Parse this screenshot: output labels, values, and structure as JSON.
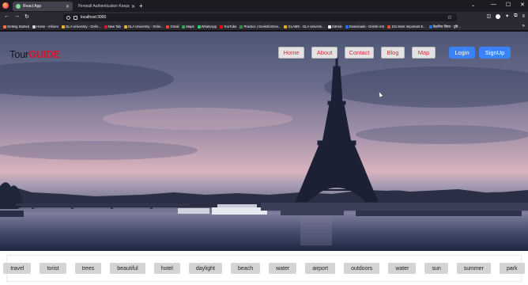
{
  "browser": {
    "tabs": [
      {
        "title": "React App",
        "active": true,
        "icon_color": "#7cd79a"
      },
      {
        "title": "Firewall Authentication Keepalive ...",
        "active": false,
        "icon_color": "#42414d"
      }
    ],
    "new_tab_label": "+",
    "url": "localhost:3000",
    "bookmarks": [
      {
        "label": "Getting Started",
        "icon_color": "#ff7139"
      },
      {
        "label": "Home - Infoom",
        "icon_color": "#cfcfd8"
      },
      {
        "label": "GLA University - Onlin...",
        "icon_color": "#e6b422"
      },
      {
        "label": "New Tab",
        "icon_color": "#d4162c"
      },
      {
        "label": "GLA University - Onlin...",
        "icon_color": "#e6b422"
      },
      {
        "label": "Gmail",
        "icon_color": "#ea4335"
      },
      {
        "label": "Maps",
        "icon_color": "#34a853"
      },
      {
        "label": "WhatsApp",
        "icon_color": "#25d366"
      },
      {
        "label": "YouTube",
        "icon_color": "#ff0000"
      },
      {
        "label": "Practice | GeeksforGee...",
        "icon_color": "#2f8d46"
      },
      {
        "label": "GLAMS - GLA Universi...",
        "icon_color": "#e6b422"
      },
      {
        "label": "GitHub",
        "icon_color": "#fbfbfe"
      },
      {
        "label": "Downloads - Drishti-IAS",
        "icon_color": "#1a73e8"
      },
      {
        "label": "101 Most Important E...",
        "icon_color": "#e34c26"
      },
      {
        "label": "वैज्ञानिक विषय - दृष्टि...",
        "icon_color": "#1a73e8"
      }
    ]
  },
  "site": {
    "logo_part1": "Tour",
    "logo_part2": "GUIDE",
    "menu": [
      "Home",
      "About",
      "Contact",
      "Blog",
      "Map"
    ],
    "auth": [
      "Login",
      "SignUp"
    ],
    "tags": [
      "travel",
      "torist",
      "trees",
      "beautiful",
      "hotel",
      "daylight",
      "beach",
      "water",
      "airport",
      "outdoors",
      "water",
      "sun",
      "summer",
      "park"
    ]
  }
}
